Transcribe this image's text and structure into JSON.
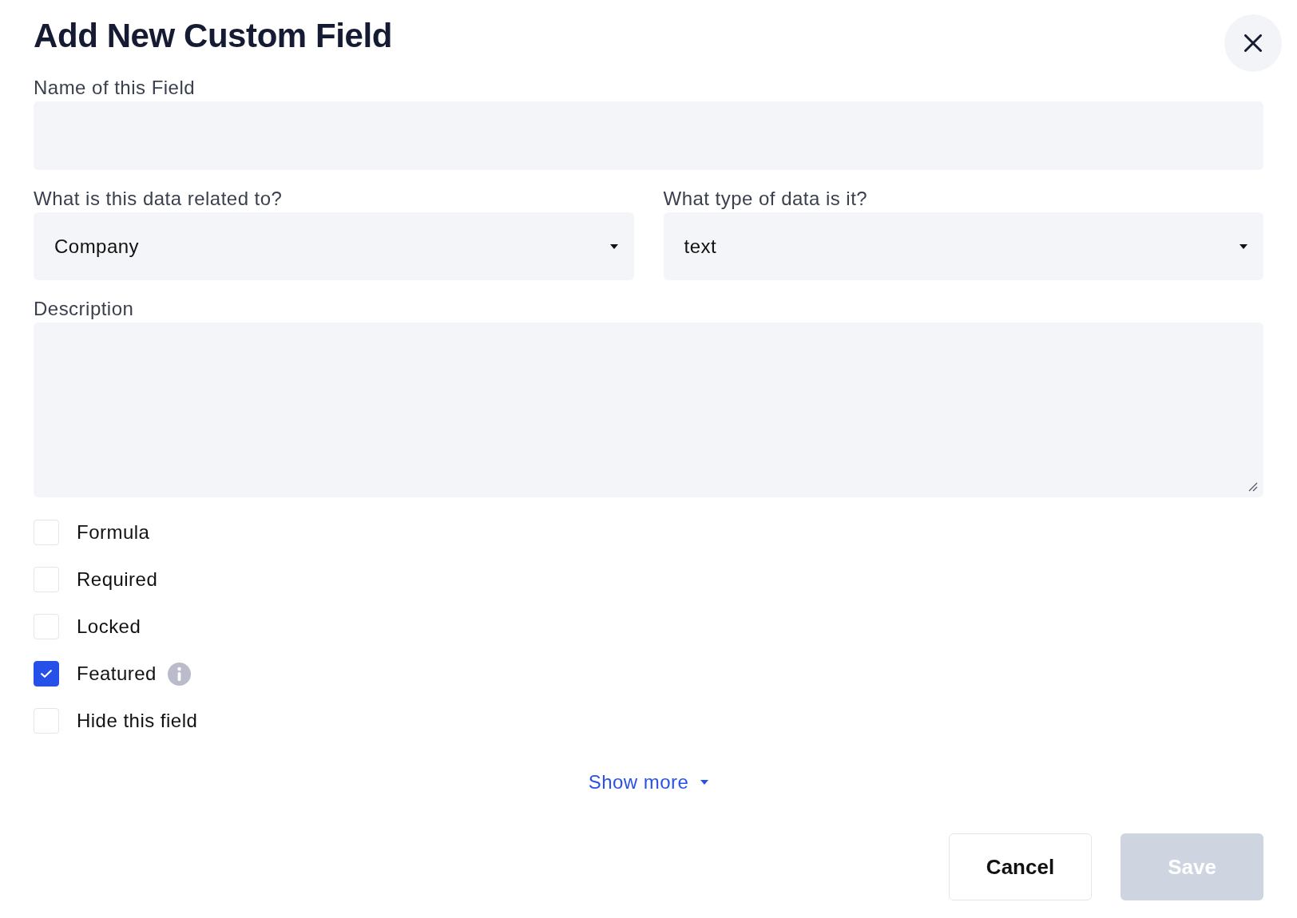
{
  "dialog": {
    "title": "Add New Custom Field"
  },
  "fields": [
    {
      "kind": "text",
      "label": "Name of this Field"
    },
    {
      "kind": "select",
      "label": "What is this data related to?",
      "value": "Company"
    },
    {
      "kind": "select",
      "label": "What type of data is it?",
      "value": "text"
    },
    {
      "kind": "textarea",
      "label": "Description"
    }
  ],
  "options": [
    {
      "label": "Formula",
      "checked": false,
      "info": false
    },
    {
      "label": "Required",
      "checked": false,
      "info": false
    },
    {
      "label": "Locked",
      "checked": false,
      "info": false
    },
    {
      "label": "Featured",
      "checked": true,
      "info": true
    },
    {
      "label": "Hide this field",
      "checked": false,
      "info": false
    }
  ],
  "show_more": {
    "label": "Show more",
    "expanded": false
  },
  "buttons": [
    {
      "label": "Cancel",
      "kind": "secondary",
      "disabled": false
    },
    {
      "label": "Save",
      "kind": "primary",
      "disabled": true
    }
  ]
}
